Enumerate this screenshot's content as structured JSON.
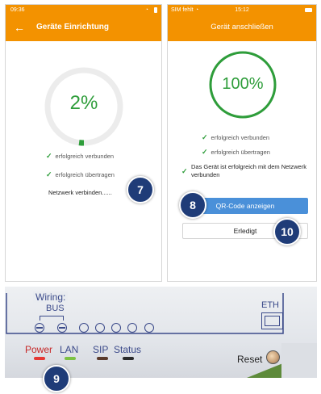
{
  "left_screen": {
    "status_time": "09:36",
    "title": "Geräte Einrichtung",
    "back_icon": "arrow-left-icon",
    "progress_percent": 2,
    "progress_label": "2%",
    "checks": [
      "erfolgreich verbunden",
      "erfolgreich übertragen"
    ],
    "status_text": "Netzwerk verbinden......"
  },
  "right_screen": {
    "status_carrier": "SIM fehlt",
    "status_time": "15:12",
    "title": "Gerät anschließen",
    "progress_percent": 100,
    "progress_label": "100%",
    "checks": [
      "erfolgreich verbunden",
      "erfolgreich übertragen",
      "Das Gerät ist erfolgreich mit dem Netzwerk verbunden"
    ],
    "qr_button_label": "QR-Code anzeigen",
    "done_button_label": "Erledigt"
  },
  "device_panel": {
    "wiring_label": "Wiring:",
    "bus_label": "BUS",
    "eth_label": "ETH",
    "led_labels": [
      "Power",
      "LAN",
      "SIP",
      "Status"
    ],
    "reset_label": "Reset"
  },
  "badges": [
    "7",
    "8",
    "9",
    "10"
  ],
  "colors": {
    "accent": "#f39200",
    "success": "#2e9d3a",
    "primary_button": "#4a90d9",
    "badge": "#1f3c78"
  }
}
